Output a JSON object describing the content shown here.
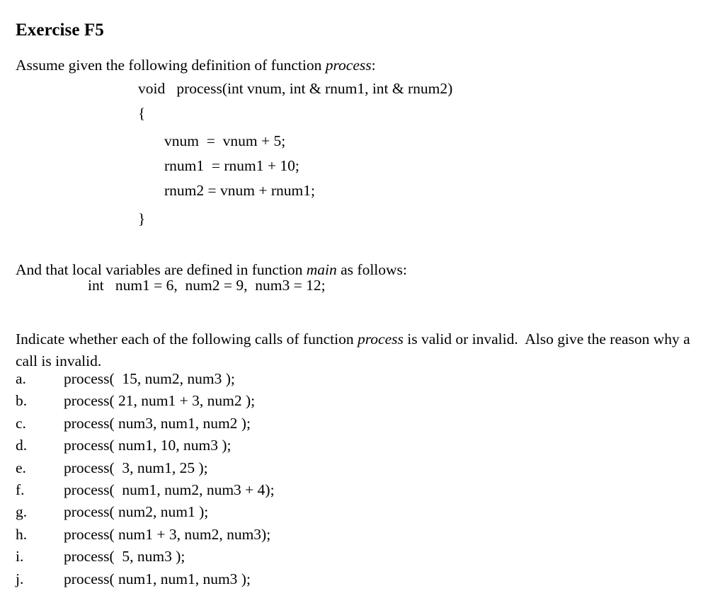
{
  "document": {
    "title": "Exercise F5",
    "intro_prefix": "Assume given the following definition of function ",
    "intro_emphasis": "process",
    "intro_suffix": ":",
    "code": {
      "signature": "void   process(int vnum, int & rnum1, int & rnum2)",
      "open_brace": "{",
      "statement_1": "vnum  =  vnum + 5;",
      "statement_2": "rnum1  = rnum1 + 10;",
      "statement_3": "rnum2 = vnum + rnum1;",
      "close_brace": "}"
    },
    "locals_prefix": "And that local variables are defined in function ",
    "locals_emphasis": "main",
    "locals_suffix": " as follows:",
    "declaration": "int   num1 = 6,  num2 = 9,  num3 = 12;",
    "instruction_prefix": "Indicate whether each of the following calls of function ",
    "instruction_emphasis": "process",
    "instruction_suffix": " is valid or invalid.  Also give the reason why a call is invalid.",
    "calls": [
      {
        "label": "a.",
        "text": "process(  15, num2, num3 );"
      },
      {
        "label": "b.",
        "text": "process( 21, num1 + 3, num2 );"
      },
      {
        "label": "c.",
        "text": "process( num3, num1, num2 );"
      },
      {
        "label": "d.",
        "text": "process( num1, 10, num3 );"
      },
      {
        "label": "e.",
        "text": "process(  3, num1, 25 );"
      },
      {
        "label": "f.",
        "text": "process(  num1, num2, num3 + 4);"
      },
      {
        "label": "g.",
        "text": "process( num2, num1 );"
      },
      {
        "label": "h.",
        "text": "process( num1 + 3, num2, num3);"
      },
      {
        "label": "i.",
        "text": "process(  5, num3 );"
      },
      {
        "label": "j.",
        "text": "process( num1, num1, num3 );"
      }
    ]
  },
  "colors": {
    "background": "#ffffff",
    "text": "#000000"
  }
}
